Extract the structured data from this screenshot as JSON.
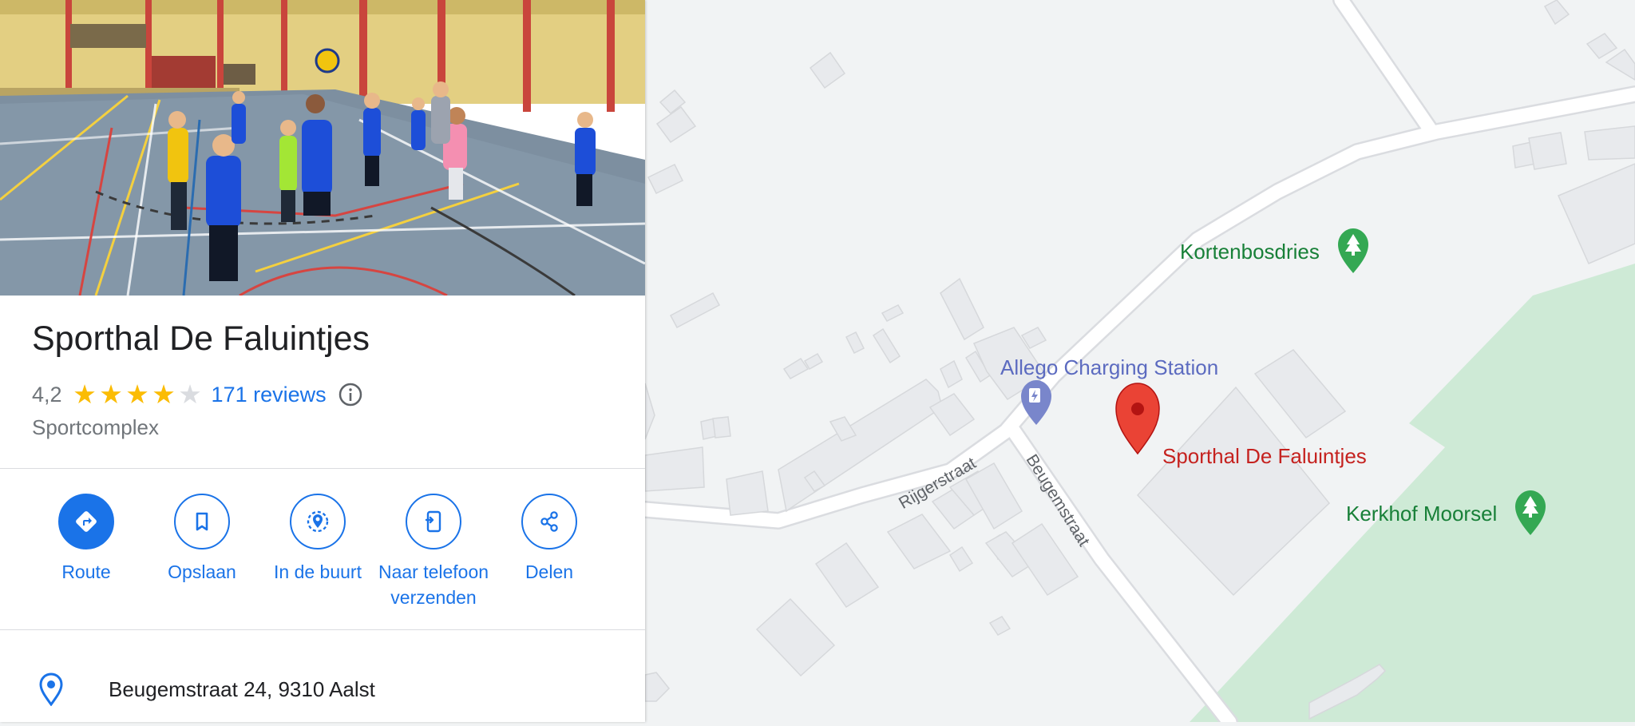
{
  "place": {
    "title": "Sporthal De Faluintjes",
    "rating": "4,2",
    "rating_stars": 4.2,
    "reviews_label": "171 reviews",
    "category": "Sportcomplex",
    "address": "Beugemstraat 24, 9310 Aalst"
  },
  "actions": [
    {
      "label": "Route",
      "icon": "directions-icon",
      "primary": true
    },
    {
      "label": "Opslaan",
      "icon": "bookmark-icon"
    },
    {
      "label": "In de buurt",
      "icon": "nearby-icon"
    },
    {
      "label": "Naar telefoon verzenden",
      "icon": "send-to-phone-icon"
    },
    {
      "label": "Delen",
      "icon": "share-icon"
    }
  ],
  "map": {
    "places": [
      {
        "name": "Kortenbosdries",
        "icon": "park-pin-icon",
        "color": "#188038"
      },
      {
        "name": "Kerkhof Moorsel",
        "icon": "cemetery-pin-icon",
        "color": "#188038"
      },
      {
        "name": "Allego Charging Station",
        "icon": "ev-charging-pin-icon",
        "color": "#5c6bc0"
      },
      {
        "name": "Sporthal De Faluintjes",
        "icon": "red-pin-icon",
        "color": "#c5221f"
      }
    ],
    "streets": [
      "Rijgerstraat",
      "Beugemstraat"
    ]
  },
  "colors": {
    "accent": "#1a73e8",
    "star": "#fbbc04",
    "map_background": "#f1f3f4",
    "park": "#ceead6",
    "road": "#ffffff",
    "building": "#e8eaed"
  }
}
